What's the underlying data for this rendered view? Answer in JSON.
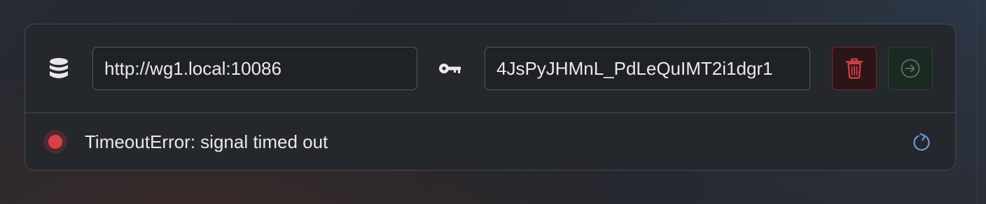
{
  "connection": {
    "url_value": "http://wg1.local:10086",
    "token_value": "4JsPyJHMnL_PdLeQuIMT2i1dgr1",
    "icons": {
      "server": "database-icon",
      "token": "key-icon",
      "delete": "trash-icon",
      "connect": "arrow-right-circle-icon",
      "refresh": "refresh-icon"
    }
  },
  "status": {
    "message": "TimeoutError: signal timed out",
    "state": "error",
    "color": "#d9404b"
  },
  "colors": {
    "danger": "#d9404b",
    "success_border": "#2c4234",
    "accent": "#6b9bd8"
  }
}
